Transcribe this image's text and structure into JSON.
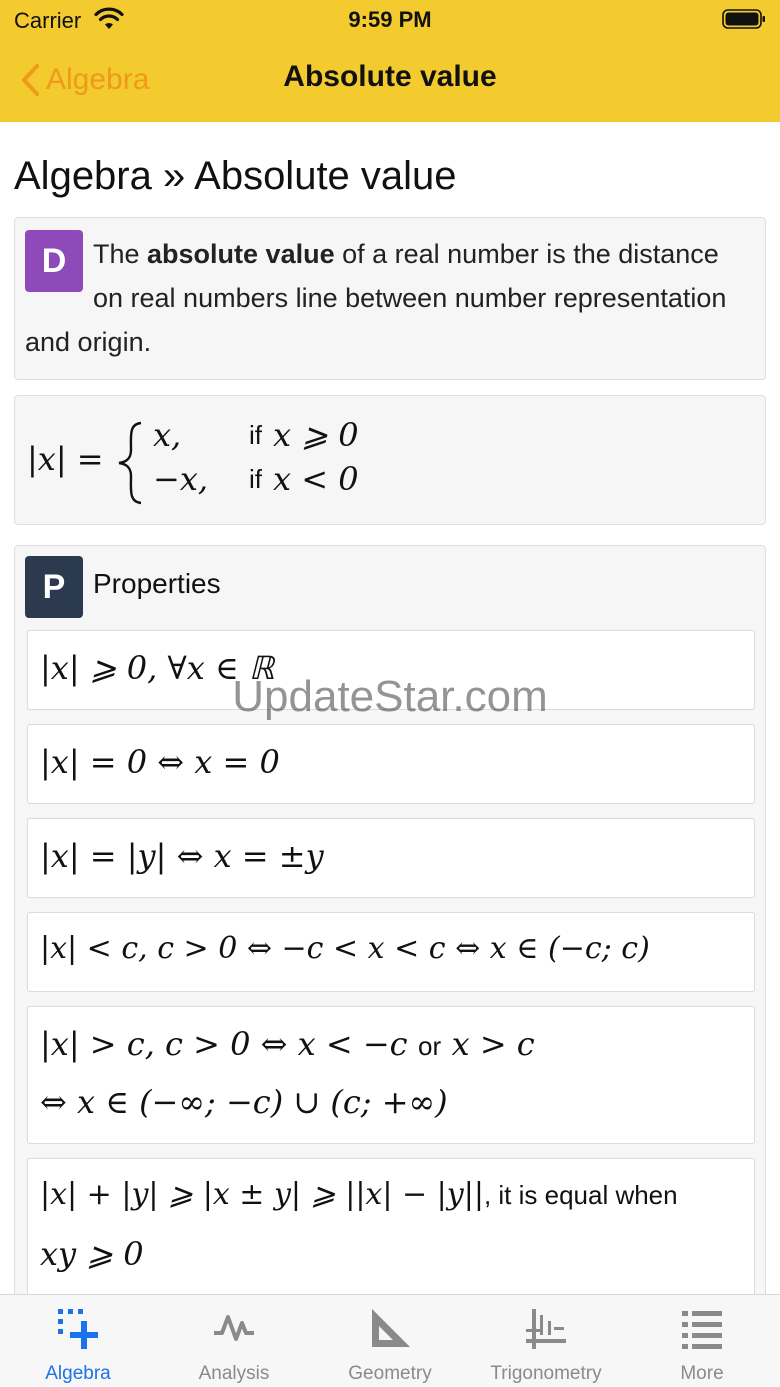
{
  "status_bar": {
    "carrier": "Carrier",
    "time": "9:59 PM"
  },
  "nav": {
    "back_label": "Algebra",
    "title": "Absolute value"
  },
  "page_title": "Algebra » Absolute value",
  "definition": {
    "badge": "D",
    "text_before": "The ",
    "text_bold": "absolute value",
    "text_after": " of a real number is the distance on real numbers line between number representation and origin."
  },
  "formula": {
    "lhs": "|x| =",
    "case1_value": "x,",
    "case1_if": "if",
    "case1_cond": "x ⩾ 0",
    "case2_value": "−x,",
    "case2_if": "if",
    "case2_cond": "x < 0"
  },
  "properties": {
    "badge": "P",
    "label": "Properties",
    "items": [
      "|x| ⩾ 0, ∀x ∈ ℝ",
      "|x| = 0 ⇔ x = 0",
      "|x| = |y| ⇔ x = ±y",
      "|x| < c,  c > 0 ⇔ −c < x < c ⇔ x ∈ (−c; c)"
    ],
    "item5_line1a": "|x| > c,  c > 0 ⇔ x < −c",
    "item5_or": "or",
    "item5_line1b": "x > c",
    "item5_line2": "⇔ x ∈ (−∞; −c) ∪ (c; +∞)",
    "item6_math": "|x| + |y| ⩾ |x ± y| ⩾ ||x| − |y||",
    "item6_text": ", it is equal when",
    "item6_line2": "xy ⩾ 0"
  },
  "watermark": "UpdateStar.com",
  "tabs": [
    {
      "label": "Algebra",
      "icon": "algebra-icon",
      "active": true
    },
    {
      "label": "Analysis",
      "icon": "analysis-icon",
      "active": false
    },
    {
      "label": "Geometry",
      "icon": "geometry-icon",
      "active": false
    },
    {
      "label": "Trigonometry",
      "icon": "trigonometry-icon",
      "active": false
    },
    {
      "label": "More",
      "icon": "more-list-icon",
      "active": false
    }
  ],
  "colors": {
    "nav_bar": "#f3cb2f",
    "back_accent": "#ee9a1a",
    "definition_badge": "#8e4ab8",
    "properties_badge": "#2b3a4f",
    "tab_active": "#1a73e8",
    "tab_inactive": "#8a8a8a"
  }
}
